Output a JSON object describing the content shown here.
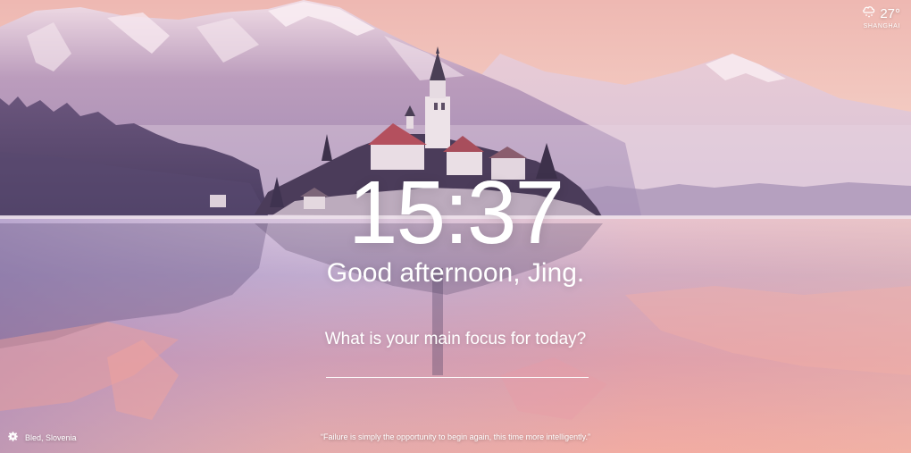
{
  "weather": {
    "icon": "cloud-snow-icon",
    "temperature": "27°",
    "location": "SHANGHAI"
  },
  "clock": {
    "time": "15:37"
  },
  "greeting": {
    "text": "Good afternoon, Jing."
  },
  "focus": {
    "prompt": "What is your main focus for today?",
    "value": ""
  },
  "footer": {
    "settings_icon": "gear-icon",
    "photo_location": "Bled, Slovenia",
    "quote": "“Failure is simply the opportunity to begin again, this time more intelligently.”"
  },
  "colors": {
    "sky_top": "#f3c2b6",
    "sky_bottom": "#f6d6cf",
    "mountain": "#b89ab8",
    "snow": "#f4e6ef",
    "forest": "#5b4a6e",
    "lake_top": "#d7bfd8",
    "lake_bottom": "#f0a8a0",
    "text": "#ffffff"
  }
}
